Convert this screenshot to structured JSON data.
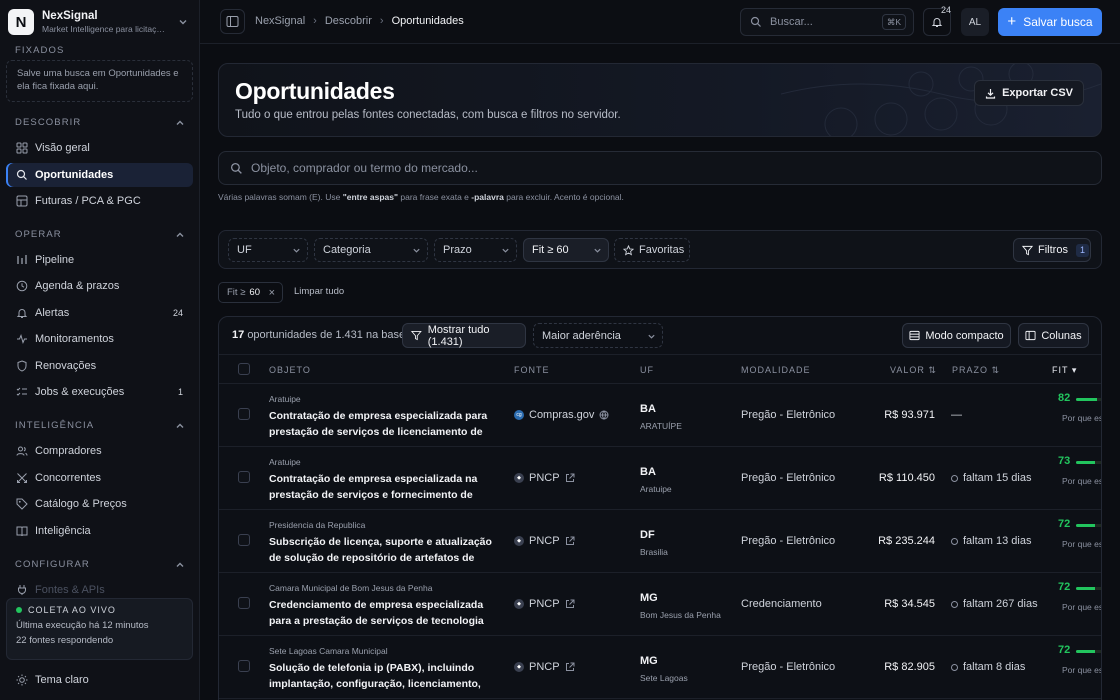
{
  "brand": {
    "name": "NexSignal",
    "subtitle": "Market Intelligence para licitações",
    "logo_letter": "N"
  },
  "sidebar": {
    "pinned": {
      "title": "FIXADOS",
      "empty_text": "Salve uma busca em Oportunidades e ela fica fixada aqui."
    },
    "sections": [
      {
        "title": "DESCOBRIR",
        "items": [
          {
            "label": "Visão geral",
            "icon": "grid-icon"
          },
          {
            "label": "Oportunidades",
            "icon": "search-icon",
            "active": true
          },
          {
            "label": "Futuras / PCA & PGC",
            "icon": "layers-icon"
          }
        ]
      },
      {
        "title": "OPERAR",
        "items": [
          {
            "label": "Pipeline",
            "icon": "pipeline-icon"
          },
          {
            "label": "Agenda & prazos",
            "icon": "clock-icon"
          },
          {
            "label": "Alertas",
            "icon": "bell-icon",
            "badge": "24"
          },
          {
            "label": "Monitoramentos",
            "icon": "pulse-icon"
          },
          {
            "label": "Renovações",
            "icon": "shield-icon"
          },
          {
            "label": "Jobs & execuções",
            "icon": "checklist-icon",
            "badge": "1"
          }
        ]
      },
      {
        "title": "INTELIGÊNCIA",
        "items": [
          {
            "label": "Compradores",
            "icon": "users-icon"
          },
          {
            "label": "Concorrentes",
            "icon": "swords-icon"
          },
          {
            "label": "Catálogo & Preços",
            "icon": "tag-icon"
          },
          {
            "label": "Inteligência",
            "icon": "book-icon"
          }
        ]
      },
      {
        "title": "CONFIGURAR",
        "items": [
          {
            "label": "Fontes & APIs",
            "icon": "plug-icon"
          }
        ]
      }
    ],
    "live": {
      "title": "COLETA AO VIVO",
      "last_run": "Última execução há 12 minutos",
      "sources": "22 fontes respondendo"
    },
    "theme_label": "Tema claro"
  },
  "topbar": {
    "breadcrumbs": [
      "NexSignal",
      "Descobrir",
      "Oportunidades"
    ],
    "search_placeholder": "Buscar...",
    "search_shortcut": "⌘K",
    "notifications_count": "24",
    "avatar_initials": "AL",
    "save_search_label": "Salvar busca"
  },
  "hero": {
    "title": "Oportunidades",
    "subtitle": "Tudo o que entrou pelas fontes conectadas, com busca e filtros no servidor.",
    "export_label": "Exportar CSV"
  },
  "main_search": {
    "placeholder": "Objeto, comprador ou termo do mercado...",
    "hint_a": "Várias palavras somam (E). Use ",
    "hint_b": "\"entre aspas\"",
    "hint_c": " para frase exata e ",
    "hint_d": "-palavra",
    "hint_e": " para excluir. Acento é opcional."
  },
  "filters": {
    "uf": "UF",
    "category": "Categoria",
    "deadline": "Prazo",
    "fit": "Fit ≥ 60",
    "favorites": "Favoritas",
    "filters_label": "Filtros",
    "filters_count": "1"
  },
  "active_chip": {
    "label": "Fit ≥",
    "value": "60"
  },
  "clear_all_label": "Limpar tudo",
  "table": {
    "count_strong": "17",
    "count_text": "oportunidades de 1.431 na base",
    "show_all_label": "Mostrar tudo (1.431)",
    "sort_label": "Maior aderência",
    "compact_label": "Modo compacto",
    "columns_label": "Colunas",
    "headers": {
      "objeto": "OBJETO",
      "fonte": "FONTE",
      "uf": "UF",
      "modalidade": "MODALIDADE",
      "valor": "VALOR ⇅",
      "prazo": "PRAZO ⇅",
      "fit": "FIT ▾"
    },
    "rows": [
      {
        "org": "Aratuipe",
        "title": "Contratação de empresa especializada para prestação de serviços de licenciamento de uso",
        "source": "Compras.gov",
        "source_icon": "globe-icon",
        "uf": "BA",
        "city": "ARATUÍPE",
        "modality": "Pregão - Eletrônico",
        "value": "R$ 93.971",
        "deadline": "—",
        "fit": "82",
        "fit_fraction": 0.82,
        "fit_note": "Por que essa pontuação"
      },
      {
        "org": "Aratuipe",
        "title": "Contratação de empresa especializada na prestação de serviços e fornecimento de",
        "source": "PNCP",
        "source_icon": "external-link-icon",
        "uf": "BA",
        "city": "Aratuipe",
        "modality": "Pregão - Eletrônico",
        "value": "R$ 110.450",
        "deadline": "faltam 15 dias",
        "fit": "73",
        "fit_fraction": 0.73,
        "fit_note": "Por que essa pontuação"
      },
      {
        "org": "Presidencia da Republica",
        "title": "Subscrição de licença, suporte e atualização de solução de repositório de artefatos de software",
        "source": "PNCP",
        "source_icon": "external-link-icon",
        "uf": "DF",
        "city": "Brasilia",
        "modality": "Pregão - Eletrônico",
        "value": "R$ 235.244",
        "deadline": "faltam 13 dias",
        "fit": "72",
        "fit_fraction": 0.72,
        "fit_note": "Por que essa pontuação"
      },
      {
        "org": "Camara Municipal de Bom Jesus da Penha",
        "title": "Credenciamento de empresa especializada para a prestação de serviços de tecnologia da",
        "source": "PNCP",
        "source_icon": "external-link-icon",
        "uf": "MG",
        "city": "Bom Jesus da Penha",
        "modality": "Credenciamento",
        "value": "R$ 34.545",
        "deadline": "faltam 267 dias",
        "fit": "72",
        "fit_fraction": 0.72,
        "fit_note": "Por que essa pontuação"
      },
      {
        "org": "Sete Lagoas Camara Municipal",
        "title": "Solução de telefonia ip (PABX), incluindo implantação, configuração, licenciamento,",
        "source": "PNCP",
        "source_icon": "external-link-icon",
        "uf": "MG",
        "city": "Sete Lagoas",
        "modality": "Pregão - Eletrônico",
        "value": "R$ 82.905",
        "deadline": "faltam 8 dias",
        "fit": "72",
        "fit_fraction": 0.72,
        "fit_note": "Por que essa pontuação"
      }
    ]
  },
  "colors": {
    "accent": "#3b82f6",
    "fit_green": "#22c55e",
    "background": "#0b0d12"
  }
}
